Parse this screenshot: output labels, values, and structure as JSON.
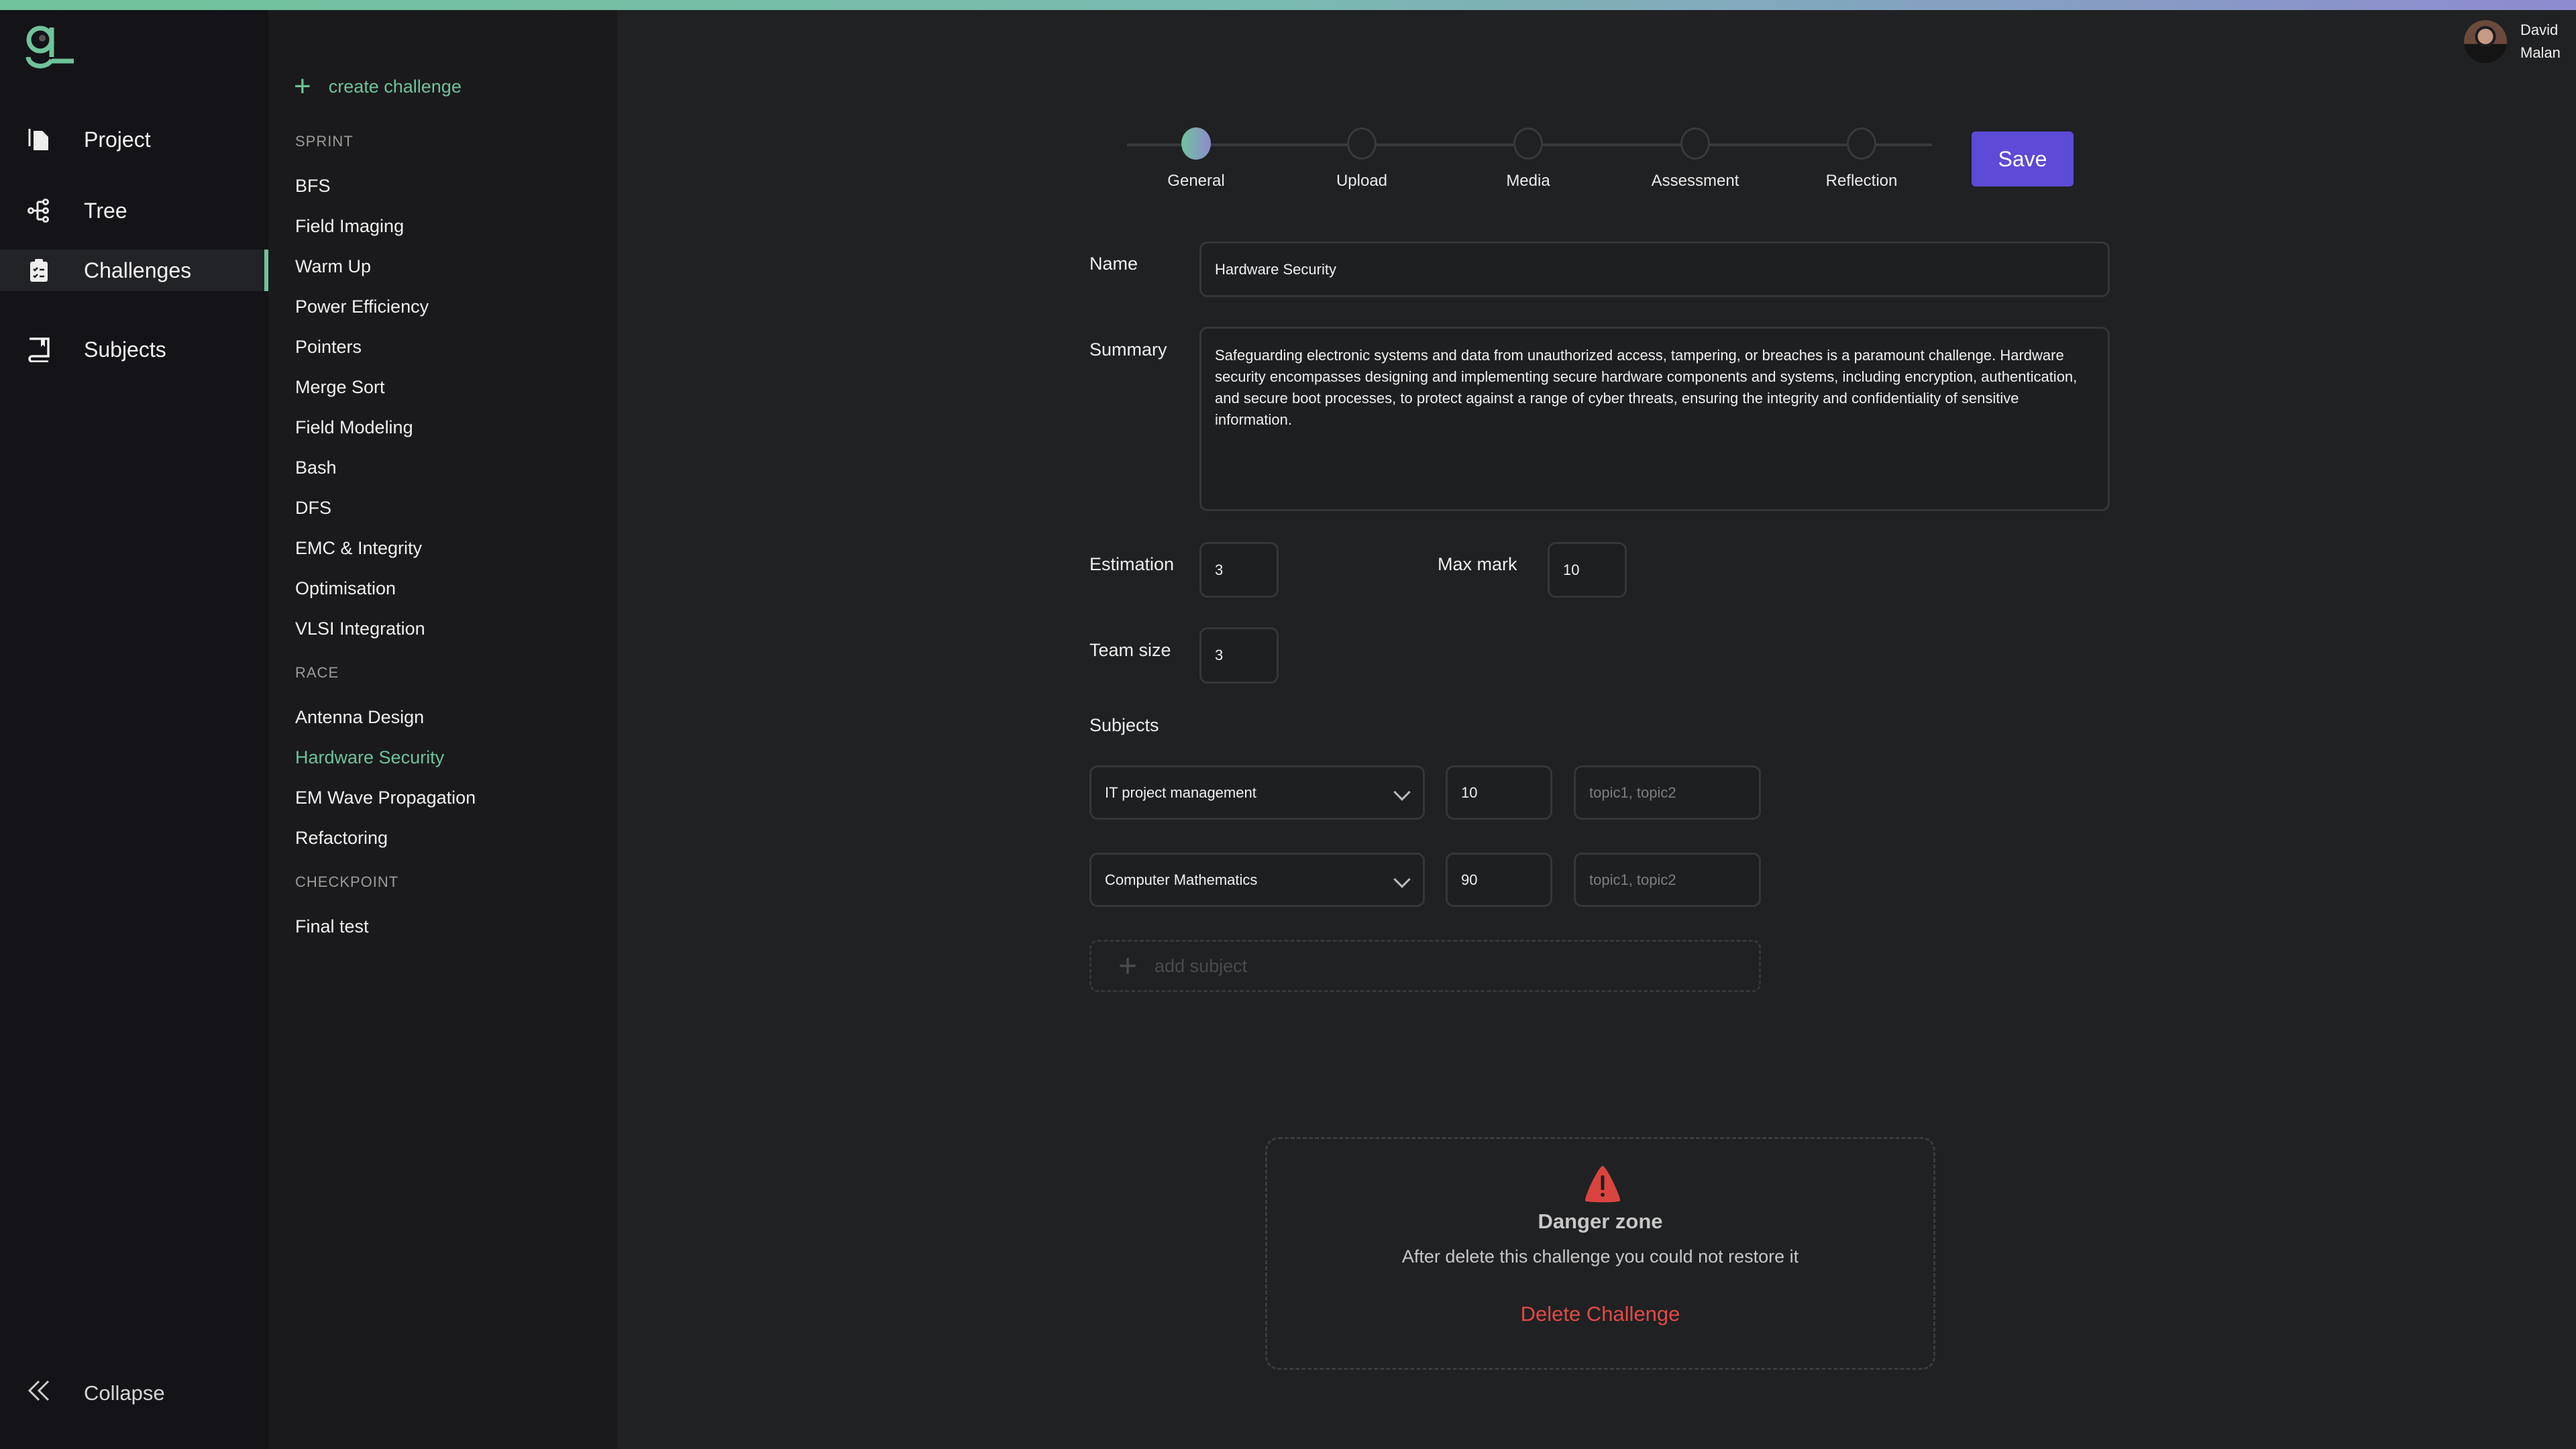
{
  "colors": {
    "accent": "#6fc39a",
    "primary": "#5b4bd6",
    "danger": "#e24a45"
  },
  "sidebar": {
    "logo": "g",
    "items": [
      {
        "label": "Project",
        "icon": "file-copy-icon"
      },
      {
        "label": "Tree",
        "icon": "tree-icon"
      },
      {
        "label": "Challenges",
        "icon": "clipboard-check-icon",
        "active": true
      },
      {
        "label": "Subjects",
        "icon": "book-icon"
      }
    ],
    "collapse": "Collapse"
  },
  "challenges": {
    "create": "create challenge",
    "sections": [
      {
        "title": "SPRINT",
        "items": [
          "BFS",
          "Field Imaging",
          "Warm Up",
          "Power Efficiency",
          "Pointers",
          "Merge Sort",
          "Field Modeling",
          "Bash",
          "DFS",
          "EMC & Integrity",
          "Optimisation",
          "VLSI Integration"
        ]
      },
      {
        "title": "RACE",
        "items": [
          "Antenna Design",
          "Hardware Security",
          "EM Wave Propagation",
          "Refactoring"
        ]
      },
      {
        "title": "CHECKPOINT",
        "items": [
          "Final test"
        ]
      }
    ],
    "selected": "Hardware Security"
  },
  "stepper": {
    "steps": [
      "General",
      "Upload",
      "Media",
      "Assessment",
      "Reflection"
    ],
    "active": 0
  },
  "save": "Save",
  "form": {
    "name_label": "Name",
    "name": "Hardware Security",
    "summary_label": "Summary",
    "summary": "Safeguarding electronic systems and data from unauthorized access, tampering, or breaches is a paramount challenge. Hardware security encompasses designing and implementing secure hardware components and systems, including encryption, authentication, and secure boot processes, to protect against a range of cyber threats, ensuring the integrity and confidentiality of sensitive information.",
    "estimation_label": "Estimation",
    "estimation": "3",
    "maxmark_label": "Max mark",
    "maxmark": "10",
    "teamsize_label": "Team size",
    "teamsize": "3",
    "subjects_label": "Subjects",
    "subjects": [
      {
        "name": "IT project management",
        "weight": "10",
        "topics_placeholder": "topic1, topic2"
      },
      {
        "name": "Computer Mathematics",
        "weight": "90",
        "topics_placeholder": "topic1, topic2"
      }
    ],
    "add_subject": "add subject"
  },
  "danger": {
    "title": "Danger zone",
    "desc": "After delete this challenge you could not restore it",
    "action": "Delete Challenge"
  },
  "user": {
    "first": "David",
    "last": "Malan"
  }
}
